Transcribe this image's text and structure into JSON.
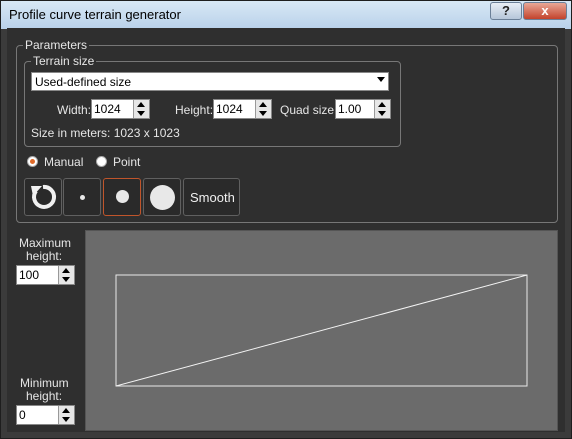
{
  "window": {
    "title": "Profile curve terrain generator",
    "help_label": "?",
    "close_label": "x"
  },
  "parameters": {
    "legend": "Parameters",
    "terrain_size": {
      "legend": "Terrain size",
      "size_mode": "Used-defined size",
      "width_label": "Width:",
      "width_value": "1024",
      "height_label": "Height:",
      "height_value": "1024",
      "quad_label": "Quad size:",
      "quad_value": "1.00",
      "size_in_meters": "Size in meters: 1023 x 1023"
    },
    "mode": {
      "manual_label": "Manual",
      "point_label": "Point",
      "selected": "Manual"
    },
    "tools": {
      "smooth_label": "Smooth",
      "selected_brush": "medium"
    }
  },
  "profile": {
    "max_label_1": "Maximum",
    "max_label_2": "height:",
    "max_value": "100",
    "min_label_1": "Minimum",
    "min_label_2": "height:",
    "min_value": "0"
  },
  "colors": {
    "accent": "#e06a28",
    "panel": "#2f2f2f",
    "canvas": "#6b6b6b"
  }
}
